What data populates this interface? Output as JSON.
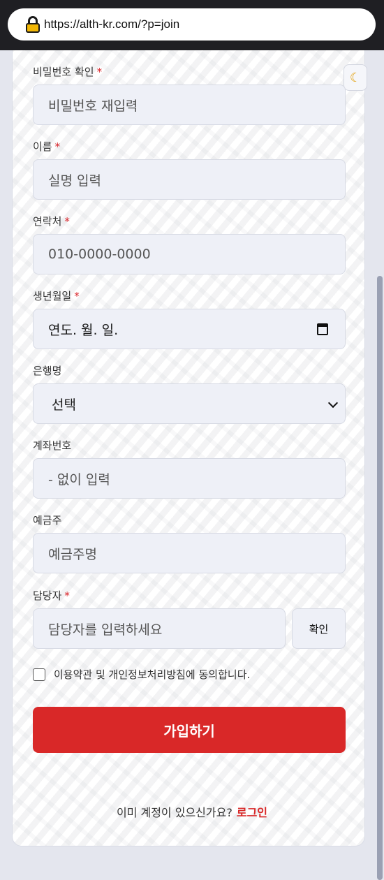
{
  "browser": {
    "url": "https://alth-kr.com/?p=join"
  },
  "theme_toggle": {
    "icon": "moon-icon",
    "glyph": "☾"
  },
  "form": {
    "password_confirm": {
      "label": "비밀번호 확인",
      "required": "*",
      "placeholder": "비밀번호 재입력"
    },
    "name": {
      "label": "이름",
      "required": "*",
      "placeholder": "실명 입력"
    },
    "phone": {
      "label": "연락처",
      "required": "*",
      "placeholder": "010-0000-0000"
    },
    "birth": {
      "label": "생년월일",
      "required": "*",
      "value": "연도. 월. 일."
    },
    "bank": {
      "label": "은행명",
      "value": "선택"
    },
    "account": {
      "label": "계좌번호",
      "placeholder": "- 없이 입력"
    },
    "holder": {
      "label": "예금주",
      "placeholder": "예금주명"
    },
    "manager": {
      "label": "담당자",
      "required": "*",
      "placeholder": "담당자를 입력하세요",
      "confirm_label": "확인"
    },
    "agree_text": "이용약관 및 개인정보처리방침에 동의합니다.",
    "submit_label": "가입하기"
  },
  "footer": {
    "login_prompt": "이미 계정이 있으신가요?",
    "login_link": "로그인"
  },
  "colors": {
    "accent": "#d92828",
    "input_bg": "#eef0f7",
    "page_bg": "#e4e6ee"
  }
}
